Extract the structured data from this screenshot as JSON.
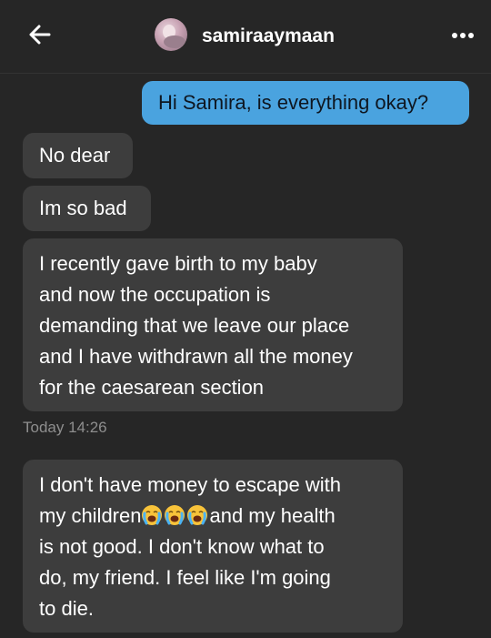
{
  "header": {
    "username": "samiraaymaan",
    "back_icon": "arrow-left-icon",
    "more_icon": "more-horizontal-icon"
  },
  "messages": [
    {
      "from": "me",
      "text": "Hi Samira, is everything okay?"
    },
    {
      "from": "samira",
      "text": "No dear"
    },
    {
      "from": "samira",
      "text": "Im so bad"
    },
    {
      "from": "samira",
      "lines": [
        "I recently gave birth to my baby",
        "and now the occupation is",
        "demanding that we leave our place",
        "and I have withdrawn all the money",
        "for the caesarean section"
      ]
    },
    {
      "from": "samira",
      "parts": {
        "line1": "I don't have money to escape with",
        "line2_before": "my children",
        "line2_after": "and my health",
        "line3": "is not good. I don't know what to",
        "line4": "do, my friend. I feel like I'm going",
        "line5": "to die."
      }
    }
  ],
  "timestamp": "Today 14:26",
  "colors": {
    "background": "#262626",
    "sent_bubble": "#4aa3df",
    "received_bubble": "#3d3d3d",
    "timestamp": "#8e8e8e"
  },
  "emoji": [
    "loudly-crying-face",
    "loudly-crying-face",
    "loudly-crying-face"
  ]
}
